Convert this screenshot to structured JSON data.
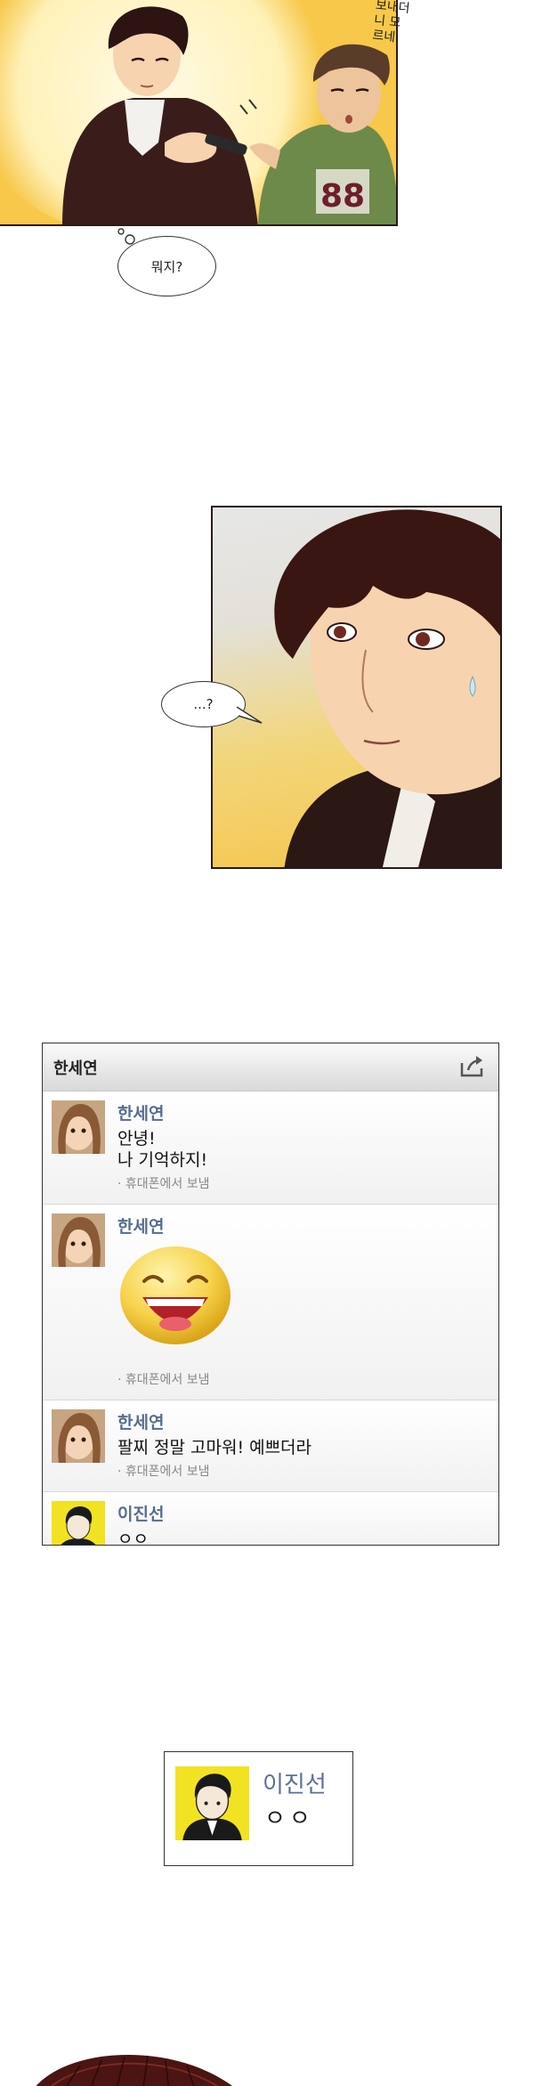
{
  "panel_top": {
    "sfx_text": "보내더니 모르네.",
    "bubble": "뭐지?"
  },
  "panel_mid": {
    "bubble": "...?"
  },
  "message_window": {
    "title": "한세연",
    "share_icon": "share-icon",
    "messages": [
      {
        "sender": "한세연",
        "lines": [
          "안녕!",
          "나 기억하지!"
        ],
        "meta": "· 휴대폰에서 보냄"
      },
      {
        "sender": "한세연",
        "emoticon": "laughing-face-emoticon",
        "meta": "· 휴대폰에서 보냄"
      },
      {
        "sender": "한세연",
        "lines": [
          "팔찌 정말 고마워! 예쁘더라"
        ],
        "meta": "· 휴대폰에서 보냄"
      },
      {
        "sender": "이진선",
        "lines": [
          "ㅇㅇ"
        ]
      }
    ]
  },
  "contact_card": {
    "name": "이진선",
    "text": "ㅇㅇ"
  },
  "colors": {
    "panel_yellow": "#f7c84a",
    "sender_blue": "#556d8f",
    "meta_gray": "#888888",
    "outline": "#2a1a1a"
  }
}
